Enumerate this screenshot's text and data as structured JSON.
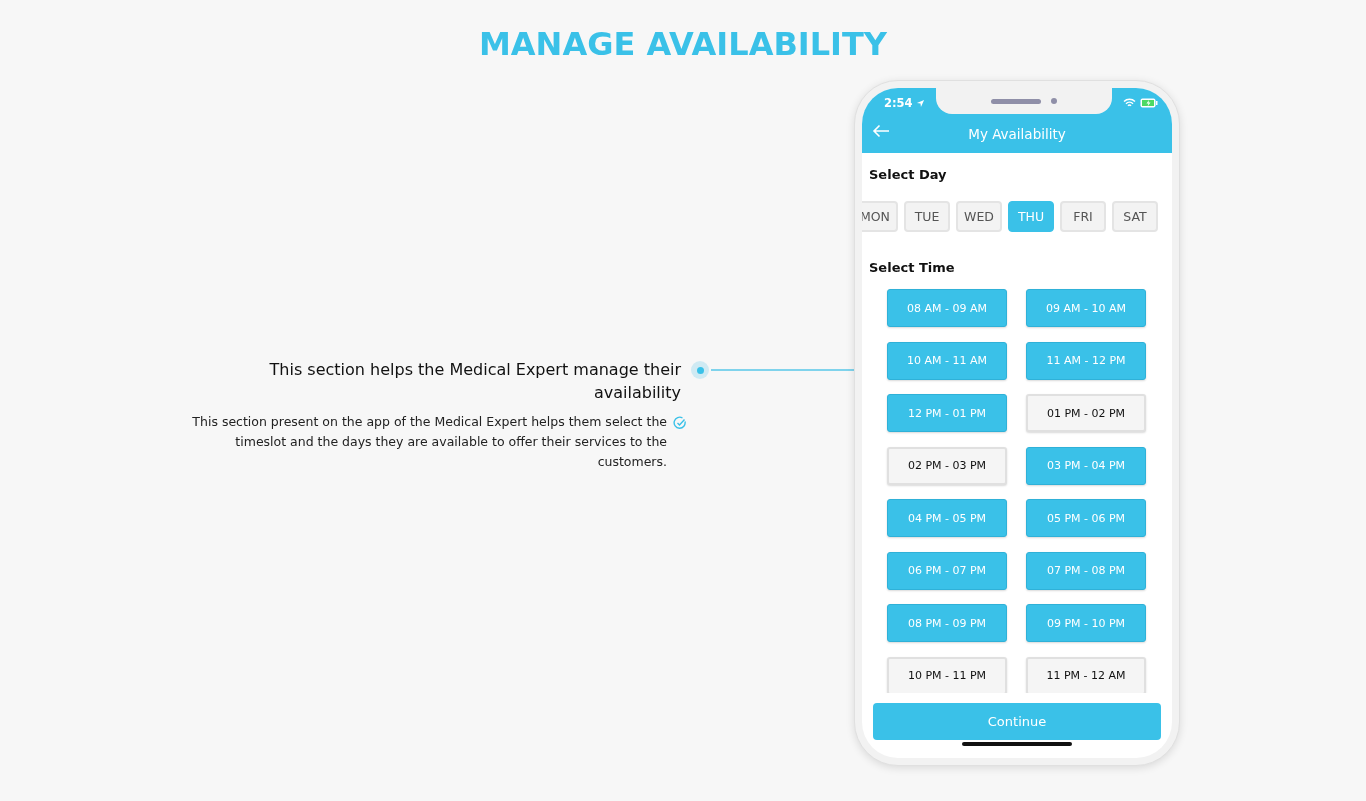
{
  "page_title": "MANAGE AVAILABILITY",
  "feature": {
    "heading": "This section helps the Medical Expert manage their availability",
    "description": "This section present on the app of the Medical Expert helps them select the timeslot and the days they are available to offer their services to the customers."
  },
  "phone": {
    "status_bar": {
      "time": "2:54"
    },
    "header": {
      "title": "My Availability"
    },
    "day_section": {
      "label": "Select Day",
      "days": [
        {
          "label": "MON",
          "selected": false
        },
        {
          "label": "TUE",
          "selected": false
        },
        {
          "label": "WED",
          "selected": false
        },
        {
          "label": "THU",
          "selected": true
        },
        {
          "label": "FRI",
          "selected": false
        },
        {
          "label": "SAT",
          "selected": false
        }
      ]
    },
    "time_section": {
      "label": "Select Time",
      "slots": [
        {
          "label": "08 AM - 09 AM",
          "selected": true
        },
        {
          "label": "09 AM - 10 AM",
          "selected": true
        },
        {
          "label": "10 AM - 11 AM",
          "selected": true
        },
        {
          "label": "11 AM - 12 PM",
          "selected": true
        },
        {
          "label": "12 PM - 01 PM",
          "selected": true
        },
        {
          "label": "01 PM - 02 PM",
          "selected": false
        },
        {
          "label": "02 PM - 03 PM",
          "selected": false
        },
        {
          "label": "03 PM - 04 PM",
          "selected": true
        },
        {
          "label": "04 PM - 05 PM",
          "selected": true
        },
        {
          "label": "05 PM - 06 PM",
          "selected": true
        },
        {
          "label": "06 PM - 07 PM",
          "selected": true
        },
        {
          "label": "07 PM - 08 PM",
          "selected": true
        },
        {
          "label": "08 PM - 09 PM",
          "selected": true
        },
        {
          "label": "09 PM - 10 PM",
          "selected": true
        },
        {
          "label": "10 PM - 11 PM",
          "selected": false
        },
        {
          "label": "11 PM - 12 AM",
          "selected": false
        }
      ]
    },
    "continue_button": "Continue"
  }
}
